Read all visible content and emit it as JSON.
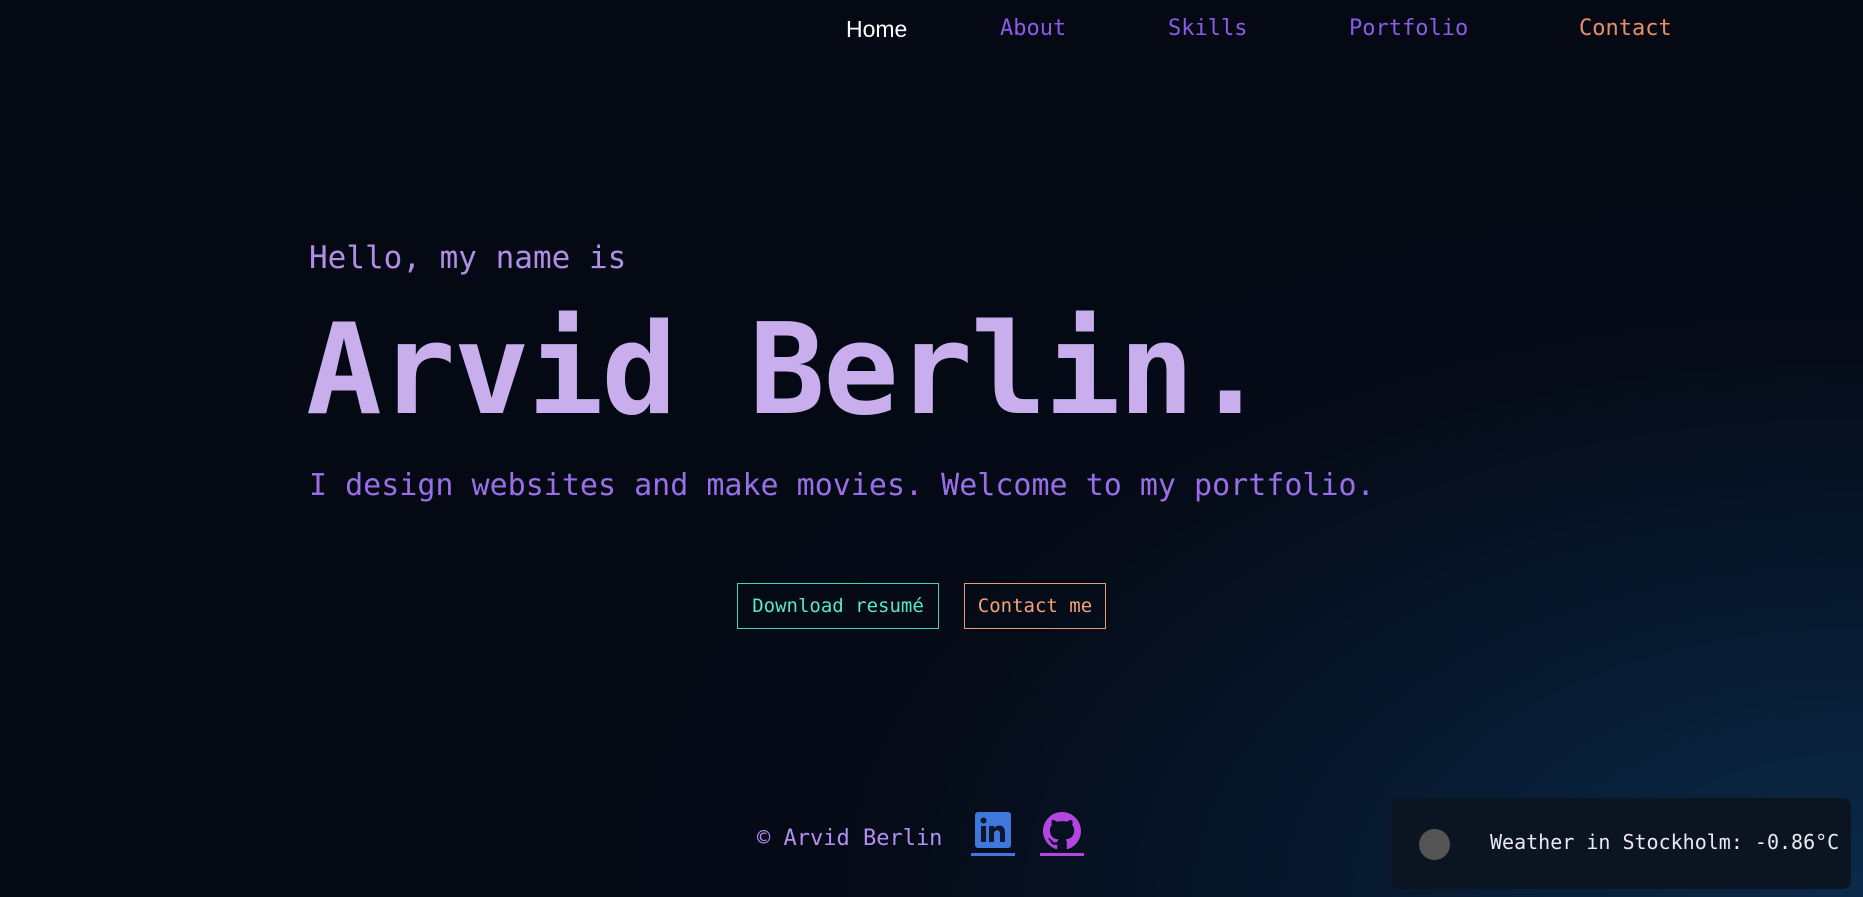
{
  "nav": {
    "items": [
      {
        "label": "Home"
      },
      {
        "label": "About"
      },
      {
        "label": "Skills"
      },
      {
        "label": "Portfolio"
      },
      {
        "label": "Contact"
      }
    ]
  },
  "hero": {
    "greeting": "Hello, my name is",
    "name": "Arvid Berlin.",
    "tagline": "I design websites and make movies. Welcome to my portfolio.",
    "resume_button": "Download resumé",
    "contact_button": "Contact me"
  },
  "footer": {
    "copyright": "© Arvid Berlin",
    "social": [
      {
        "icon": "linkedin-icon",
        "color": "#3f77dd"
      },
      {
        "icon": "github-icon",
        "color": "#b545e0"
      }
    ]
  },
  "weather": {
    "text": "Weather in Stockholm: -0.86°C",
    "icon": "weather-icon"
  },
  "colors": {
    "accent": "#8b5be6",
    "name": "#c8aeec",
    "contact": "#e98f68",
    "resume": "#57e8c6"
  }
}
